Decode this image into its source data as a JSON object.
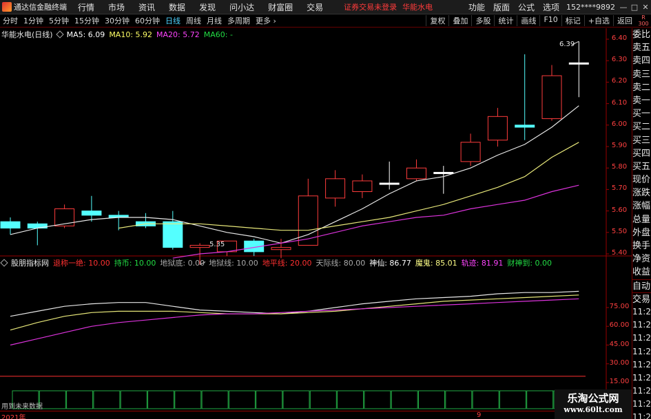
{
  "titlebar": {
    "app_title": "通达信金融终端",
    "menu": [
      "行情",
      "市场",
      "资讯",
      "数据",
      "发现",
      "问小达",
      "财富圈",
      "交易"
    ],
    "warning": "证券交易未登录",
    "stock_name": "华能水电",
    "right_menu": [
      "功能",
      "版面",
      "公式",
      "选项"
    ],
    "user": "152****9892",
    "window_buttons": [
      "—",
      "□",
      "✕"
    ]
  },
  "toolbar": {
    "periods": [
      "分时",
      "1分钟",
      "5分钟",
      "15分钟",
      "30分钟",
      "60分钟",
      "日线",
      "周线",
      "月线",
      "多周期",
      "更多 ›"
    ],
    "active": "日线",
    "buttons": [
      "复权",
      "叠加",
      "多股",
      "统计",
      "画线",
      "F10",
      "标记",
      "+自选",
      "返回"
    ],
    "badge": "R 300"
  },
  "main_info": {
    "title": "华能水电(日线)",
    "ma5": "MA5: 6.09",
    "ma10": "MA10: 5.92",
    "ma20": "MA20: 5.72",
    "ma60": "MA60: -"
  },
  "indicator_info": {
    "title": "股朋指标网",
    "items": [
      {
        "text": "退称一绝: 10.00",
        "color": "#ff3030"
      },
      {
        "text": "持币: 10.00",
        "color": "#22dd44"
      },
      {
        "text": "地狱底: 0.00",
        "color": "#aaaaaa"
      },
      {
        "text": "地狱线: 10.00",
        "color": "#aaaaaa"
      },
      {
        "text": "地平线: 20.00",
        "color": "#ff3030"
      },
      {
        "text": "天际线: 80.00",
        "color": "#aaaaaa"
      },
      {
        "text": "神仙: 86.77",
        "color": "#ffffff"
      },
      {
        "text": "魔鬼: 85.01",
        "color": "#ffff88"
      },
      {
        "text": "轨迹: 81.91",
        "color": "#ff44ff"
      },
      {
        "text": "财神到: 0.00",
        "color": "#22dd44"
      }
    ]
  },
  "price_axis": [
    "6.40",
    "6.30",
    "6.20",
    "6.10",
    "6.00",
    "5.90",
    "5.80",
    "5.70",
    "5.60",
    "5.50",
    "5.40"
  ],
  "indicator_axis": [
    "75.00",
    "60.00",
    "45.00",
    "30.00",
    "15.00"
  ],
  "annotations": {
    "high": "6.39",
    "low": "5.35"
  },
  "side_panel": {
    "items": [
      "委比",
      "卖五",
      "卖四",
      "卖三",
      "卖二",
      "卖一",
      "买一",
      "买二",
      "买三",
      "买四",
      "买五",
      "现价",
      "涨跌",
      "涨幅",
      "总量",
      "外盘",
      "换手",
      "净资",
      "收益"
    ],
    "tabs": [
      "自动",
      "交易"
    ],
    "times": [
      "11:29",
      "11:29",
      "11:29",
      "11:29",
      "11:29",
      "11:29",
      "11:29",
      "11:29",
      "11:29",
      "11:29"
    ]
  },
  "status": {
    "left_text": "用到未来数据",
    "year": "2021年",
    "month": "9"
  },
  "watermark": {
    "line1": "乐淘公式网",
    "line2": "www.60lt.com"
  },
  "chart_data": {
    "type": "candlestick",
    "ylim": [
      5.35,
      6.45
    ],
    "candles": [
      {
        "o": 5.55,
        "h": 5.57,
        "l": 5.49,
        "c": 5.52
      },
      {
        "o": 5.54,
        "h": 5.55,
        "l": 5.44,
        "c": 5.52
      },
      {
        "o": 5.53,
        "h": 5.63,
        "l": 5.52,
        "c": 5.61
      },
      {
        "o": 5.6,
        "h": 5.67,
        "l": 5.55,
        "c": 5.58
      },
      {
        "o": 5.58,
        "h": 5.6,
        "l": 5.51,
        "c": 5.57
      },
      {
        "o": 5.55,
        "h": 5.59,
        "l": 5.52,
        "c": 5.53
      },
      {
        "o": 5.55,
        "h": 5.6,
        "l": 5.42,
        "c": 5.43
      },
      {
        "o": 5.43,
        "h": 5.45,
        "l": 5.35,
        "c": 5.44
      },
      {
        "o": 5.41,
        "h": 5.46,
        "l": 5.39,
        "c": 5.46
      },
      {
        "o": 5.46,
        "h": 5.47,
        "l": 5.39,
        "c": 5.41
      },
      {
        "o": 5.42,
        "h": 5.47,
        "l": 5.38,
        "c": 5.43
      },
      {
        "o": 5.44,
        "h": 5.75,
        "l": 5.44,
        "c": 5.67
      },
      {
        "o": 5.66,
        "h": 5.79,
        "l": 5.62,
        "c": 5.75
      },
      {
        "o": 5.69,
        "h": 5.77,
        "l": 5.66,
        "c": 5.74
      },
      {
        "o": 5.73,
        "h": 5.83,
        "l": 5.7,
        "c": 5.73
      },
      {
        "o": 5.75,
        "h": 5.84,
        "l": 5.74,
        "c": 5.8
      },
      {
        "o": 5.78,
        "h": 5.81,
        "l": 5.68,
        "c": 5.78
      },
      {
        "o": 5.83,
        "h": 5.96,
        "l": 5.81,
        "c": 5.92
      },
      {
        "o": 5.93,
        "h": 6.08,
        "l": 5.9,
        "c": 6.04
      },
      {
        "o": 6.0,
        "h": 6.33,
        "l": 5.93,
        "c": 5.99
      },
      {
        "o": 6.03,
        "h": 6.28,
        "l": 6.02,
        "c": 6.23
      },
      {
        "o": 6.29,
        "h": 6.39,
        "l": 6.13,
        "c": 6.29
      }
    ],
    "ma5": [
      5.49,
      5.52,
      5.54,
      5.56,
      5.57,
      5.57,
      5.56,
      5.53,
      5.5,
      5.48,
      5.45,
      5.49,
      5.55,
      5.61,
      5.68,
      5.74,
      5.76,
      5.8,
      5.86,
      5.91,
      5.99,
      6.09
    ],
    "ma10": [
      null,
      null,
      null,
      null,
      5.52,
      5.54,
      5.54,
      5.54,
      5.53,
      5.52,
      5.51,
      5.51,
      5.53,
      5.55,
      5.57,
      5.6,
      5.63,
      5.67,
      5.71,
      5.76,
      5.85,
      5.92
    ],
    "ma20": [
      null,
      null,
      null,
      null,
      null,
      null,
      5.38,
      5.4,
      5.41,
      5.43,
      5.45,
      5.47,
      5.5,
      5.53,
      5.55,
      5.57,
      5.58,
      5.61,
      5.63,
      5.65,
      5.69,
      5.72
    ],
    "indicator": {
      "ylim": [
        10,
        95
      ],
      "white": [
        68,
        72,
        76,
        78,
        79,
        79,
        76,
        73,
        72,
        71,
        70,
        72,
        75,
        78,
        80,
        82,
        83,
        84,
        86,
        87,
        87,
        88
      ],
      "yellow": [
        57,
        63,
        68,
        71,
        72,
        72,
        72,
        71,
        70,
        70,
        70,
        71,
        72,
        74,
        76,
        78,
        80,
        81,
        82,
        83,
        84,
        85
      ],
      "magenta": [
        45,
        50,
        55,
        60,
        63,
        65,
        67,
        69,
        70,
        70,
        71,
        72,
        73,
        74,
        75,
        76,
        77,
        78,
        79,
        80,
        81,
        82
      ],
      "red_levels": [
        20
      ]
    }
  }
}
